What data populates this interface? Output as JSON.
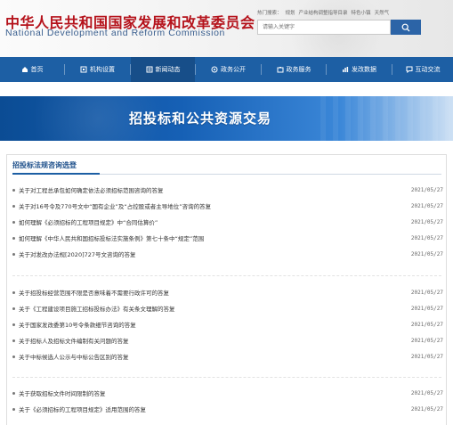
{
  "header": {
    "site_title_cn": "中华人民共和国国家发展和改革委员会",
    "site_title_en": "National Development and Reform Commission",
    "hot_search_label": "热门搜索：",
    "hot_terms": [
      "规划",
      "产业结构调整指导目录",
      "特色小镇",
      "天然气"
    ],
    "search_placeholder": "请输入关键字"
  },
  "nav": [
    {
      "label": "首页",
      "icon": "home-icon"
    },
    {
      "label": "机构设置",
      "icon": "org-icon"
    },
    {
      "label": "新闻动态",
      "icon": "news-icon",
      "active": true
    },
    {
      "label": "政务公开",
      "icon": "gov-icon"
    },
    {
      "label": "政务服务",
      "icon": "service-icon"
    },
    {
      "label": "发改数据",
      "icon": "data-icon"
    },
    {
      "label": "互动交流",
      "icon": "chat-icon"
    }
  ],
  "banner": {
    "title": "招投标和公共资源交易"
  },
  "section": {
    "title": "招投标法规咨询选登"
  },
  "groups": [
    [
      {
        "title": "关于对工程总承包如何确定依法必须招标范围咨询的答复",
        "date": "2021/05/27"
      },
      {
        "title": "关于对16号令及770号文中“国有企业”及“占控股或者主导地位”咨询的答复",
        "date": "2021/05/27"
      },
      {
        "title": "如何理解《必须招标的工程项目规定》中“合同估算价”",
        "date": "2021/05/27"
      },
      {
        "title": "如何理解《中华人民共和国招标投标法实施条例》第七十条中“规定”范围",
        "date": "2021/05/27"
      },
      {
        "title": "关于对发改办法规[2020]727号文咨询的答复",
        "date": "2021/05/27"
      }
    ],
    [
      {
        "title": "关于招投标经营范围不限是否意味着不需要行政许可的答复",
        "date": "2021/05/27"
      },
      {
        "title": "关于《工程建设项目施工招标投标办法》有关条文理解的答复",
        "date": "2021/05/27"
      },
      {
        "title": "关于国家发改委第10号令条款细节咨询的答复",
        "date": "2021/05/27"
      },
      {
        "title": "关于招标人及招标文件编制有关问题的答复",
        "date": "2021/05/27"
      },
      {
        "title": "关于中标候选人公示与中标公告区别的答复",
        "date": "2021/05/27"
      }
    ],
    [
      {
        "title": "关于获取招标文件时间限制的答复",
        "date": "2021/05/27"
      },
      {
        "title": "关于《必须招标的工程项目规定》适用范围的答复",
        "date": "2021/05/27"
      }
    ]
  ],
  "colors": {
    "brand_red": "#b5121b",
    "nav_blue": "#1d5fa4",
    "section_blue": "#1d4f8a"
  }
}
